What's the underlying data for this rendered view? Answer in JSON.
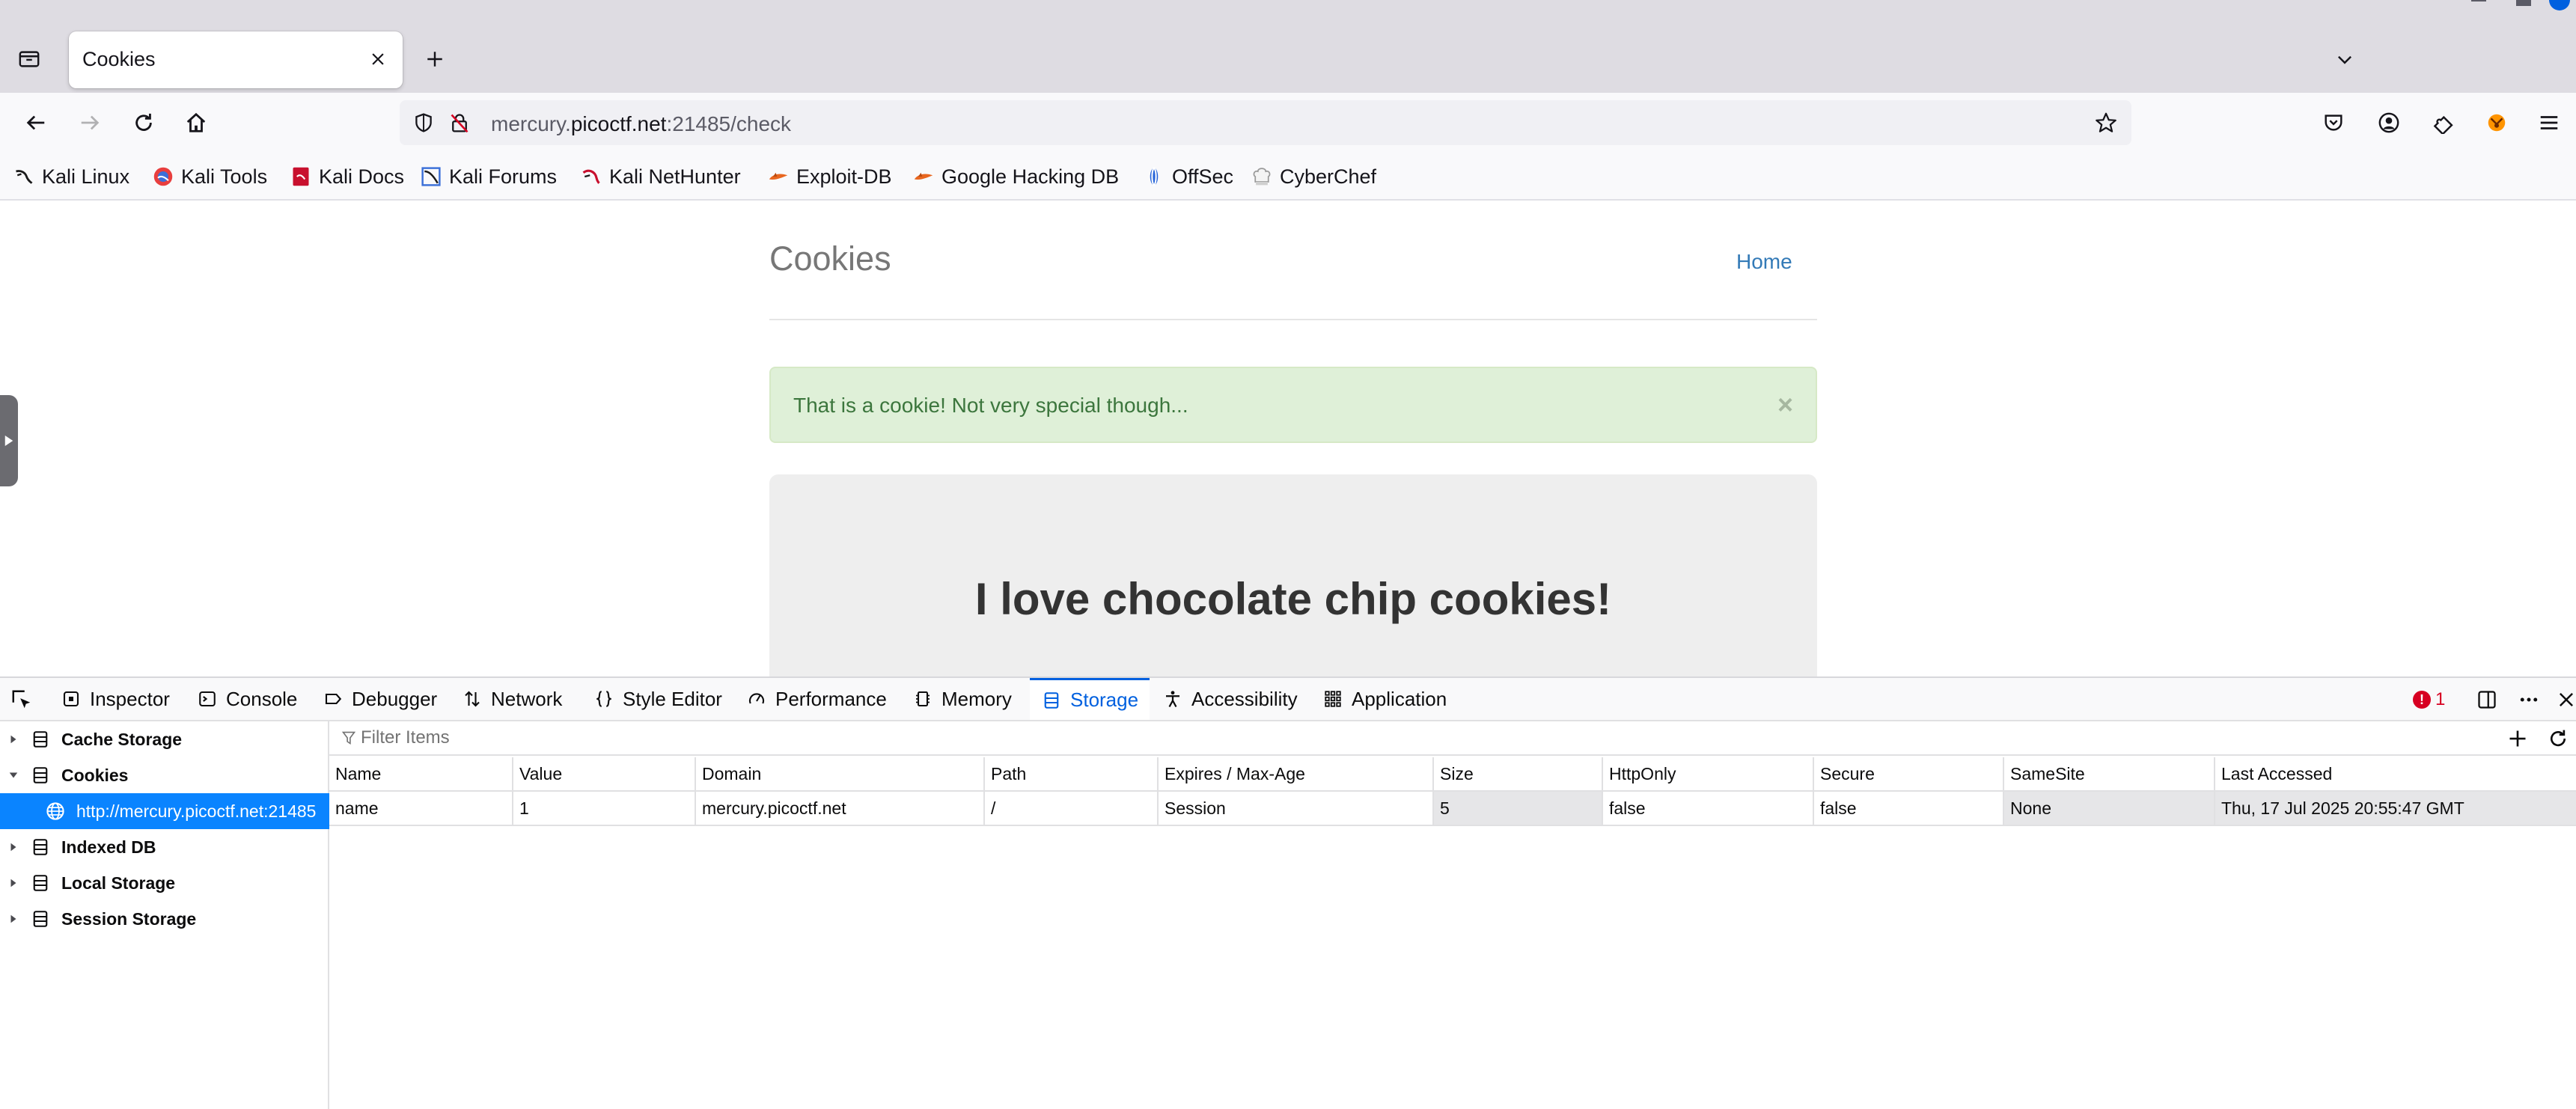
{
  "browser": {
    "tab": {
      "title": "Cookies"
    },
    "url": {
      "host": "mercury.picoctf.net",
      "prefix": "mercury.",
      "domain_main": "picoctf.net",
      "rest": ":21485/check"
    },
    "bookmarks": [
      {
        "label": "Kali Linux",
        "icon": "kali-icon"
      },
      {
        "label": "Kali Tools",
        "icon": "kali-tools-icon"
      },
      {
        "label": "Kali Docs",
        "icon": "kali-docs-icon"
      },
      {
        "label": "Kali Forums",
        "icon": "kali-forums-icon"
      },
      {
        "label": "Kali NetHunter",
        "icon": "nethunter-icon"
      },
      {
        "label": "Exploit-DB",
        "icon": "exploit-db-icon"
      },
      {
        "label": "Google Hacking DB",
        "icon": "ghdb-icon"
      },
      {
        "label": "OffSec",
        "icon": "offsec-icon"
      },
      {
        "label": "CyberChef",
        "icon": "cyberchef-icon"
      }
    ]
  },
  "page": {
    "title": "Cookies",
    "nav_home": "Home",
    "alert": {
      "text": "That is a cookie! Not very special though...",
      "close": "×"
    },
    "jumbotron": "I love chocolate chip cookies!"
  },
  "devtools": {
    "tabs": [
      {
        "label": "Inspector",
        "icon": "inspector-icon"
      },
      {
        "label": "Console",
        "icon": "console-icon"
      },
      {
        "label": "Debugger",
        "icon": "debugger-icon"
      },
      {
        "label": "Network",
        "icon": "network-icon"
      },
      {
        "label": "Style Editor",
        "icon": "style-editor-icon"
      },
      {
        "label": "Performance",
        "icon": "performance-icon"
      },
      {
        "label": "Memory",
        "icon": "memory-icon"
      },
      {
        "label": "Storage",
        "icon": "storage-icon",
        "selected": true
      },
      {
        "label": "Accessibility",
        "icon": "accessibility-icon"
      },
      {
        "label": "Application",
        "icon": "application-icon"
      }
    ],
    "error_count": "1",
    "storage_tree": [
      {
        "label": "Cache Storage",
        "expanded": false
      },
      {
        "label": "Cookies",
        "expanded": true
      },
      {
        "label": "http://mercury.picoctf.net:21485",
        "child": true,
        "selected": true
      },
      {
        "label": "Indexed DB",
        "expanded": false
      },
      {
        "label": "Local Storage",
        "expanded": false
      },
      {
        "label": "Session Storage",
        "expanded": false
      }
    ],
    "filter_placeholder": "Filter Items",
    "table": {
      "columns": [
        "Name",
        "Value",
        "Domain",
        "Path",
        "Expires / Max-Age",
        "Size",
        "HttpOnly",
        "Secure",
        "SameSite",
        "Last Accessed"
      ],
      "rows": [
        [
          "name",
          "1",
          "mercury.picoctf.net",
          "/",
          "Session",
          "5",
          "false",
          "false",
          "None",
          "Thu, 17 Jul 2025 20:55:47 GMT"
        ]
      ]
    }
  },
  "colors": {
    "accent": "#0060df",
    "selection": "#0a84ff",
    "alert_bg": "#dff0d8",
    "alert_text": "#3c763d",
    "link": "#337ab7"
  }
}
